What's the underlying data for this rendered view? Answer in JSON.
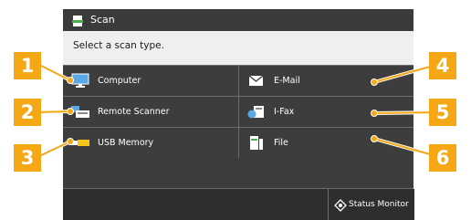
{
  "window": {
    "title": "Scan",
    "title_icon": "scan-document-icon"
  },
  "prompt": "Select a scan type.",
  "options": [
    {
      "label": "Computer",
      "icon": "computer-monitor-icon"
    },
    {
      "label": "E-Mail",
      "icon": "envelope-icon"
    },
    {
      "label": "Remote Scanner",
      "icon": "remote-scanner-icon"
    },
    {
      "label": "I-Fax",
      "icon": "ifax-icon"
    },
    {
      "label": "USB Memory",
      "icon": "usb-memory-icon"
    },
    {
      "label": "File",
      "icon": "file-server-icon"
    }
  ],
  "bottom_bar": {
    "status_monitor_label": "Status Monitor",
    "icon": "status-monitor-icon"
  },
  "callouts": [
    "1",
    "2",
    "3",
    "4",
    "5",
    "6"
  ],
  "colors": {
    "callout": "#f5a716",
    "titlebar": "#3b3b3b",
    "grid": "#3d3d3d",
    "bottombar": "#2e2e2e"
  }
}
